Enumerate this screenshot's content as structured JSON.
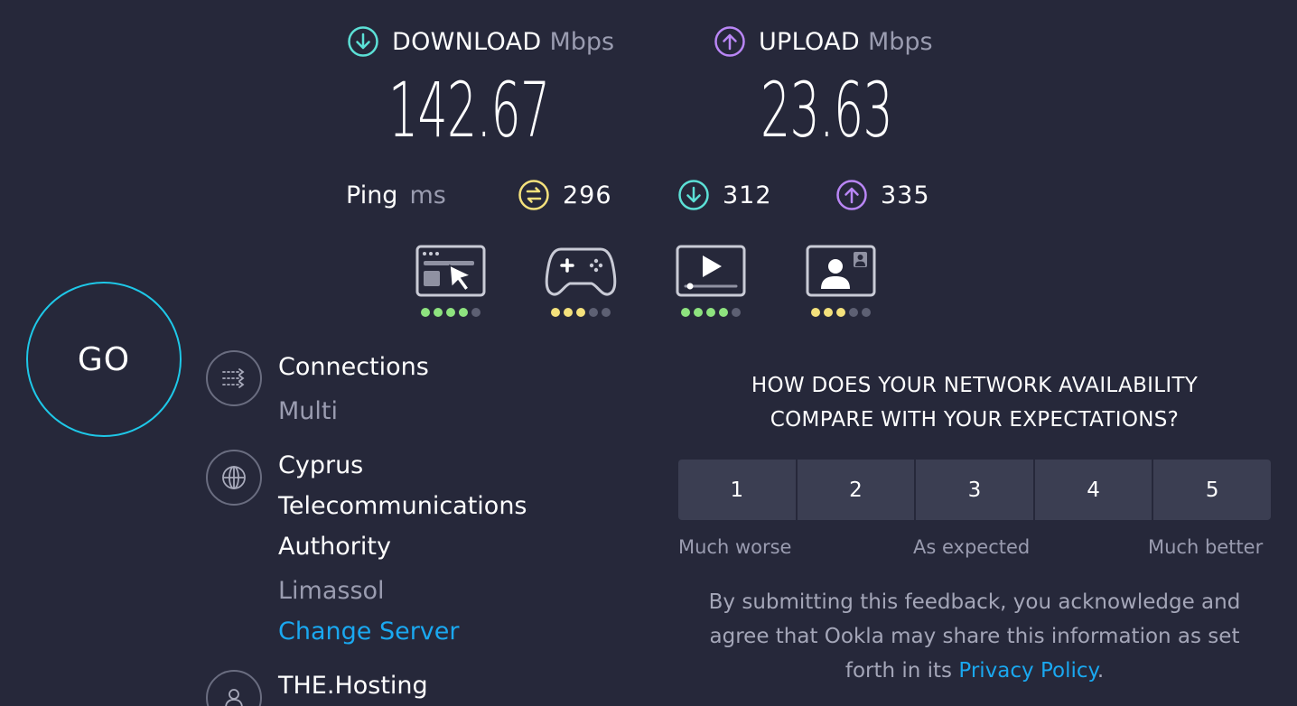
{
  "download": {
    "label": "DOWNLOAD",
    "unit": "Mbps",
    "value": "142.67",
    "icon": "download-arrow-icon",
    "color": "#5ce0d6"
  },
  "upload": {
    "label": "UPLOAD",
    "unit": "Mbps",
    "value": "23.63",
    "icon": "upload-arrow-icon",
    "color": "#b986f5"
  },
  "ping": {
    "label": "Ping",
    "unit": "ms",
    "idle": {
      "value": "296",
      "icon": "idle-latency-icon",
      "color": "#f4e17c"
    },
    "download": {
      "value": "312",
      "icon": "download-latency-icon",
      "color": "#5ce0d6"
    },
    "upload": {
      "value": "335",
      "icon": "upload-latency-icon",
      "color": "#b986f5"
    }
  },
  "quality": [
    {
      "name": "web-browsing-icon",
      "rating": 4,
      "max": 5,
      "color": "#8ee37f"
    },
    {
      "name": "gaming-icon",
      "rating": 3,
      "max": 5,
      "color": "#f4e17c"
    },
    {
      "name": "video-streaming-icon",
      "rating": 4,
      "max": 5,
      "color": "#8ee37f"
    },
    {
      "name": "video-chat-icon",
      "rating": 3,
      "max": 5,
      "color": "#f4e17c"
    }
  ],
  "go": {
    "label": "GO",
    "ring_color": "#1ec8e8"
  },
  "connections": {
    "title": "Connections",
    "value": "Multi",
    "icon": "connections-icon"
  },
  "server": {
    "title_lines": [
      "Cyprus",
      "Telecommunications",
      "Authority"
    ],
    "location": "Limassol",
    "change_label": "Change Server",
    "icon": "globe-icon"
  },
  "host": {
    "title": "THE.Hosting",
    "icon": "user-icon"
  },
  "survey": {
    "question_lines": [
      "HOW DOES YOUR NETWORK AVAILABILITY",
      "COMPARE WITH YOUR EXPECTATIONS?"
    ],
    "options": [
      "1",
      "2",
      "3",
      "4",
      "5"
    ],
    "scale_low": "Much worse",
    "scale_mid": "As expected",
    "scale_high": "Much better",
    "disclaimer_lines": [
      "By submitting this feedback, you acknowledge and",
      "agree that Ookla may share this information as set"
    ],
    "disclaimer_tail": "forth in its",
    "privacy_link": "Privacy Policy",
    "disclaimer_end": "."
  },
  "colors": {
    "background": "#26283a",
    "link": "#1aa8f0",
    "muted": "#9a9cb0"
  }
}
